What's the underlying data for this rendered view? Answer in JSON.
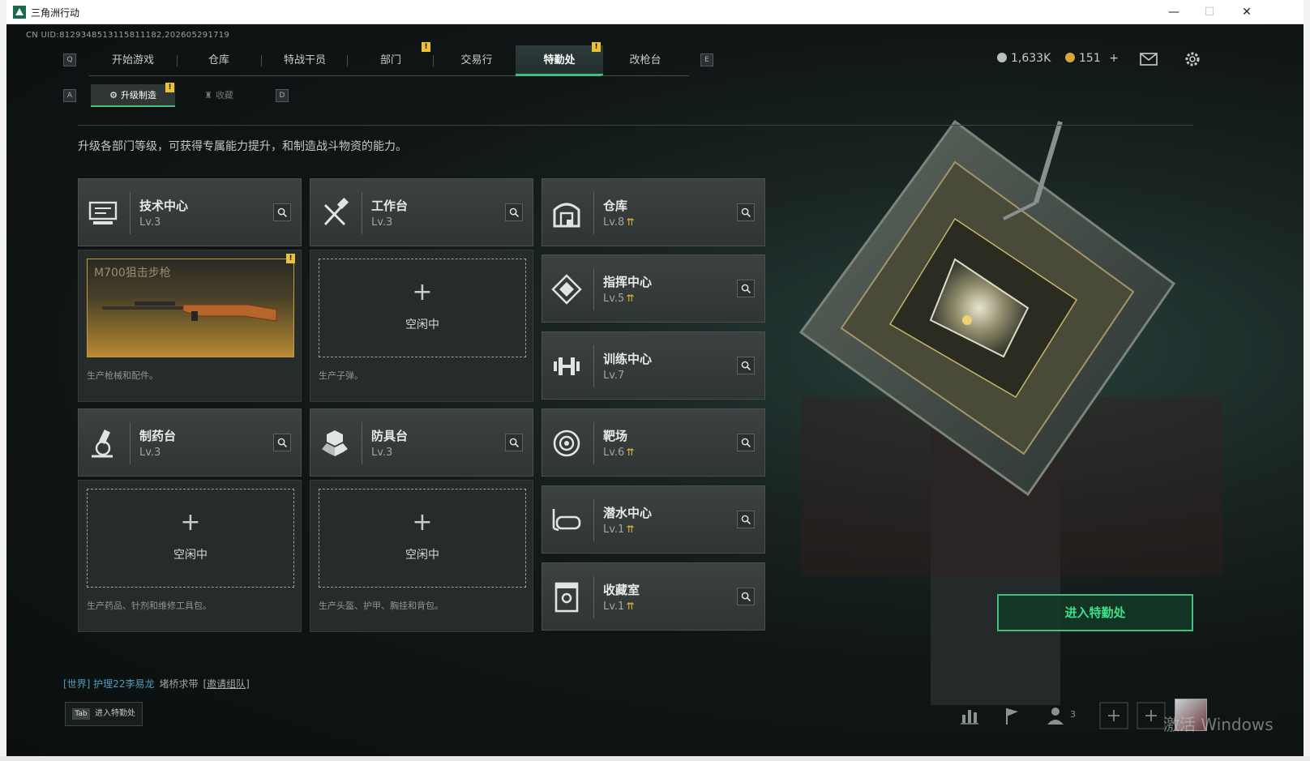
{
  "window": {
    "title": "三角洲行动",
    "minimize": "—",
    "maximize": "☐",
    "close": "✕"
  },
  "uid": "CN UID:8129348513115811182,202605291719",
  "nav": {
    "left_key": "Q",
    "right_key": "E",
    "tabs": [
      {
        "label": "开始游戏"
      },
      {
        "label": "仓库"
      },
      {
        "label": "特战干员"
      },
      {
        "label": "部门",
        "badge": "!"
      },
      {
        "label": "交易行"
      },
      {
        "label": "特勤处",
        "badge": "!",
        "active": true
      },
      {
        "label": "改枪台"
      }
    ]
  },
  "currency": {
    "silver": "1,633K",
    "gold": "151",
    "gold_add": "+"
  },
  "subnav": {
    "left_key": "A",
    "right_key": "D",
    "tabs": [
      {
        "label": "升级制造",
        "badge": "!",
        "active": true
      },
      {
        "label": "收藏"
      }
    ]
  },
  "description": "升级各部门等级，可获得专属能力提升，和制造战斗物资的能力。",
  "departments": [
    {
      "name": "技术中心",
      "level": "Lv.3",
      "icon": "monitor-icon"
    },
    {
      "name": "工作台",
      "level": "Lv.3",
      "icon": "tools-icon"
    },
    {
      "name": "仓库",
      "level": "Lv.8",
      "upgradable": true,
      "icon": "warehouse-icon"
    },
    {
      "name": "指挥中心",
      "level": "Lv.5",
      "upgradable": true,
      "icon": "command-icon"
    },
    {
      "name": "训练中心",
      "level": "Lv.7",
      "icon": "dumbbell-icon"
    },
    {
      "name": "制药台",
      "level": "Lv.3",
      "icon": "microscope-icon"
    },
    {
      "name": "防具台",
      "level": "Lv.3",
      "icon": "armor-icon"
    },
    {
      "name": "靶场",
      "level": "Lv.6",
      "upgradable": true,
      "icon": "target-icon"
    },
    {
      "name": "潜水中心",
      "level": "Lv.1",
      "upgradable": true,
      "icon": "diving-mask-icon"
    },
    {
      "name": "收藏室",
      "level": "Lv.1",
      "upgradable": true,
      "icon": "collection-icon"
    }
  ],
  "upgrade_glyph": "⇈",
  "production": [
    {
      "item": "M700狙击步枪",
      "note": "生产枪械和配件。",
      "badge": "!"
    },
    {
      "status": "空闲中",
      "note": "生产子弹。",
      "plus": "+"
    },
    {
      "status": "空闲中",
      "note": "生产药品、针剂和维修工具包。",
      "plus": "+"
    },
    {
      "status": "空闲中",
      "note": "生产头盔、护甲、胸挂和背包。",
      "plus": "+"
    }
  ],
  "enter_button": "进入特勤处",
  "chat": {
    "channel": "[世界] 护理22李易龙",
    "message": "堵桥求带",
    "invite": "[邀请组队]"
  },
  "tab_hint": {
    "key": "Tab",
    "label": "进入特勤处"
  },
  "friends_count": "3",
  "watermark": "激活 Windows",
  "colors": {
    "accent": "#3fc07e",
    "badge": "#e8c33a",
    "upgrade": "#e6b73a"
  }
}
